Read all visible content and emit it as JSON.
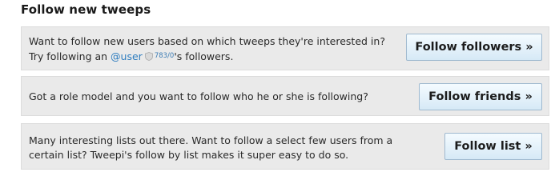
{
  "heading": "Follow new tweeps",
  "panels": [
    {
      "text_before": "Want to follow new users based on which tweeps they're interested in? Try following an ",
      "user_link": "@user",
      "stats": "783/0",
      "text_after": "'s followers.",
      "button": "Follow followers »"
    },
    {
      "text": "Got a role model and you want to follow who he or she is following?",
      "button": "Follow friends »"
    },
    {
      "text": "Many interesting lists out there. Want to follow a select few users from a certain list? Tweepi's follow by list makes it super easy to do so.",
      "button": "Follow list »"
    }
  ],
  "icons": {
    "user_badge": "shield-icon"
  },
  "colors": {
    "link": "#2f7dbf",
    "panel_bg": "#eaeaea",
    "button_top": "#f4fbff",
    "button_bottom": "#d6e9f6"
  }
}
